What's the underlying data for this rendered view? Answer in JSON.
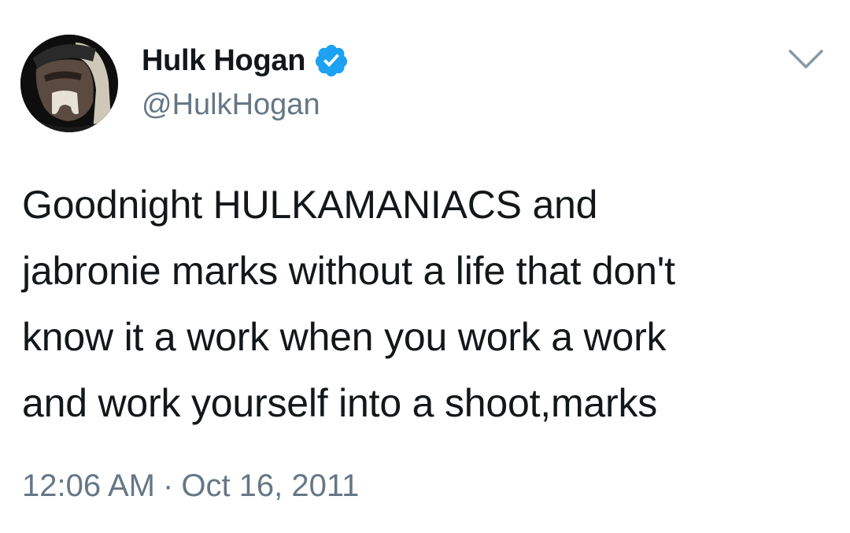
{
  "author": {
    "display_name": "Hulk Hogan",
    "handle": "@HulkHogan",
    "verified": true,
    "verified_color": "#1da1f2"
  },
  "tweet": {
    "text": "Goodnight HULKAMANIACS and\njabronie marks without a life that don't\nknow it a work when you work a work\nand work yourself into a shoot,marks",
    "time": "12:06 AM",
    "separator": "·",
    "date": "Oct 16, 2011"
  },
  "icons": {
    "menu": "chevron-down-icon",
    "verified": "verified-badge-icon",
    "avatar": "profile-photo"
  },
  "colors": {
    "text": "#14171a",
    "secondary": "#657786",
    "background": "#ffffff"
  }
}
